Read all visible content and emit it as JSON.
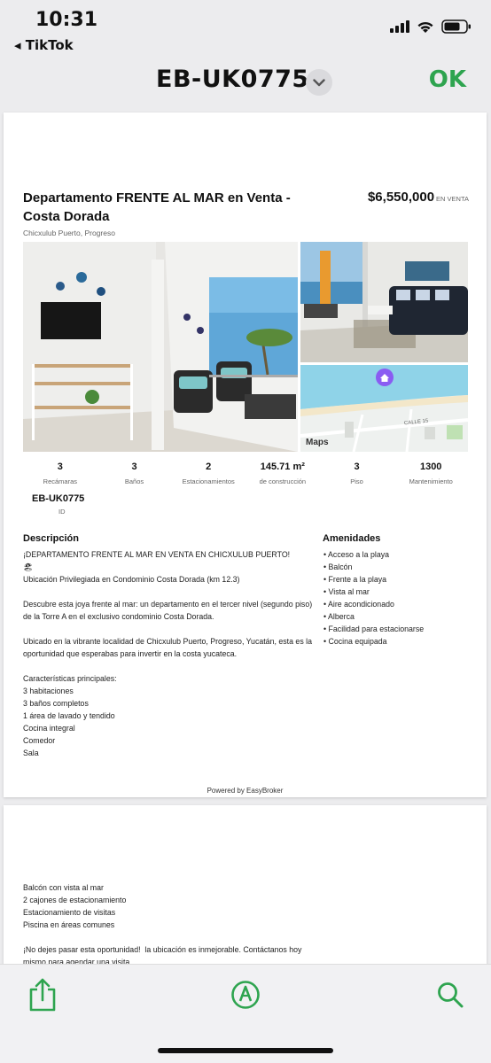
{
  "status_bar": {
    "time": "10:31",
    "back_app": "◂ TikTok"
  },
  "nav": {
    "title": "EB-UK0775",
    "ok_label": "OK"
  },
  "listing": {
    "title": "Departamento FRENTE AL MAR en Venta - Costa Dorada",
    "price": "$6,550,000",
    "price_tag": "EN VENTA",
    "location": "Chicxulub Puerto, Progreso",
    "map_label": "Maps",
    "map_street": "CALLE 15",
    "stats": [
      {
        "value": "3",
        "label": "Recámaras"
      },
      {
        "value": "3",
        "label": "Baños"
      },
      {
        "value": "2",
        "label": "Estacionamientos"
      },
      {
        "value": "145.71 m²",
        "label": "de construcción"
      },
      {
        "value": "3",
        "label": "Piso"
      },
      {
        "value": "1300",
        "label": "Mantenimiento"
      }
    ],
    "id_value": "EB-UK0775",
    "id_label": "ID",
    "description_heading": "Descripción",
    "description": "¡DEPARTAMENTO FRENTE AL MAR EN VENTA EN CHICXULUB PUERTO!\n🏖\nUbicación Privilegiada en Condominio Costa Dorada (km 12.3)\n\nDescubre esta joya frente al mar: un departamento en el tercer nivel (segundo piso) de la Torre A en el exclusivo condominio Costa Dorada.\n\nUbicado en la vibrante localidad de Chicxulub Puerto, Progreso, Yucatán, esta es la oportunidad que esperabas para invertir en la costa yucateca.\n\nCaracterísticas principales:\n3 habitaciones\n3 baños completos\n1 área de lavado y tendido\nCocina integral\nComedor\nSala",
    "amenities_heading": "Amenidades",
    "amenities": [
      "Acceso a la playa",
      "Balcón",
      "Frente a la playa",
      "Vista al mar",
      "Aire acondicionado",
      "Alberca",
      "Facilidad para estacionarse",
      "Cocina equipada"
    ],
    "powered_by": "Powered by EasyBroker",
    "description_continued": "Balcón con vista al mar\n2 cajones de estacionamiento\nEstacionamiento de visitas\nPiscina en áreas comunes\n\n¡No dejes pasar esta oportunidad!  la ubicación es inmejorable. Contáctanos hoy mismo para agendar una visita."
  },
  "icons": {
    "share": "share-icon",
    "markup": "markup-pen-icon",
    "search": "search-icon"
  },
  "colors": {
    "accent": "#2ea44f"
  }
}
